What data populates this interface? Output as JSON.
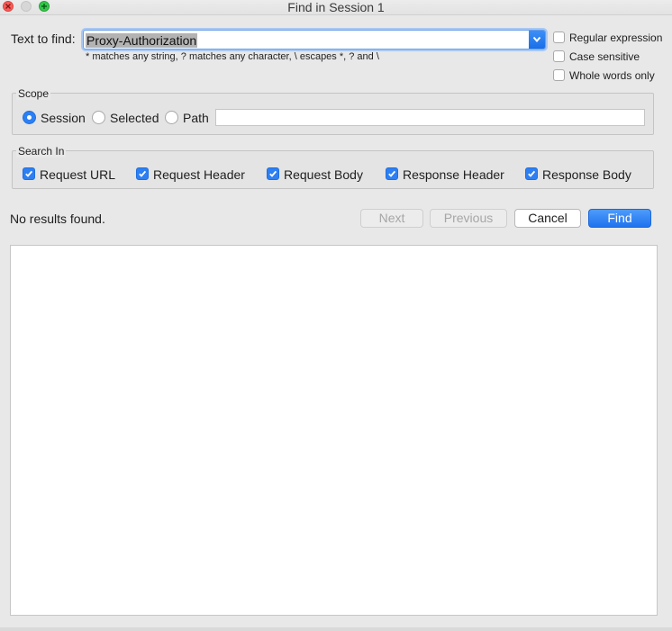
{
  "window": {
    "title": "Find in Session 1"
  },
  "find": {
    "label": "Text to find:",
    "value": "Proxy-Authorization",
    "hint": "* matches any string, ? matches any character, \\ escapes *, ? and \\"
  },
  "options": [
    {
      "label": "Regular expression",
      "checked": false
    },
    {
      "label": "Case sensitive",
      "checked": false
    },
    {
      "label": "Whole words only",
      "checked": false
    }
  ],
  "scope": {
    "title": "Scope",
    "options": [
      {
        "label": "Session",
        "selected": true
      },
      {
        "label": "Selected",
        "selected": false
      },
      {
        "label": "Path",
        "selected": false
      }
    ],
    "path_value": ""
  },
  "search_in": {
    "title": "Search In",
    "items": [
      {
        "label": "Request URL",
        "checked": true
      },
      {
        "label": "Request Header",
        "checked": true
      },
      {
        "label": "Request Body",
        "checked": true
      },
      {
        "label": "Response Header",
        "checked": true
      },
      {
        "label": "Response Body",
        "checked": true
      }
    ]
  },
  "status": "No results found.",
  "buttons": {
    "next": "Next",
    "previous": "Previous",
    "cancel": "Cancel",
    "find": "Find"
  },
  "colors": {
    "accent": "#2d7ff2",
    "close": "#fc5b57",
    "maximize": "#34c84a"
  }
}
